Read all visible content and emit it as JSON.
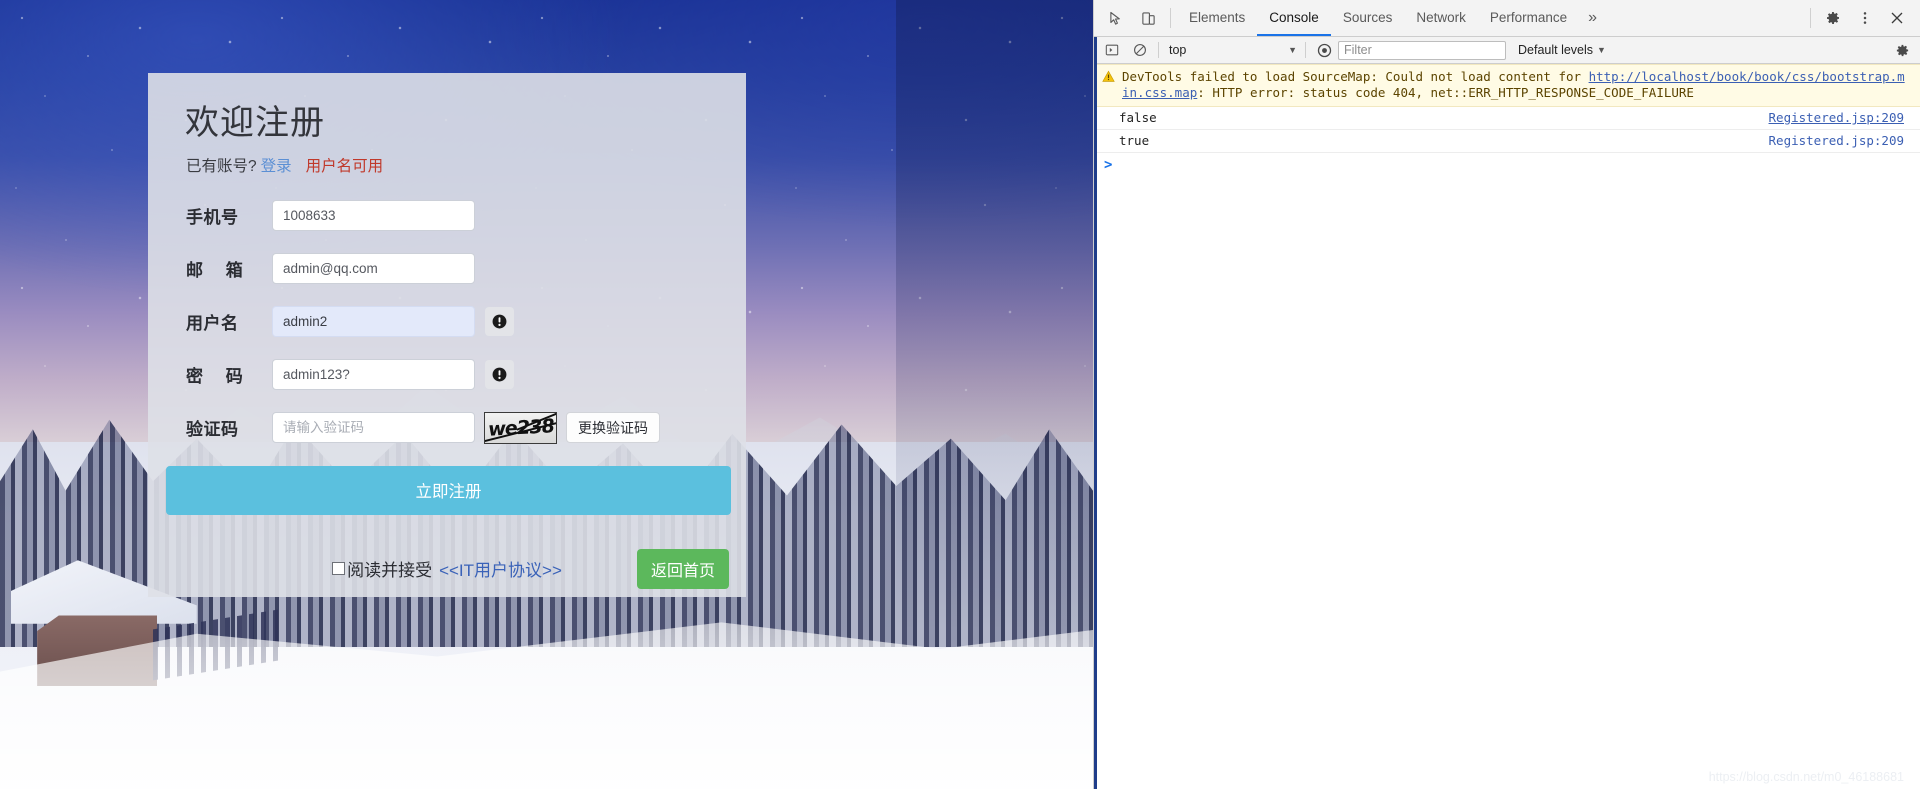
{
  "page": {
    "card": {
      "title": "欢迎注册",
      "have_account_text": "已有账号?",
      "login_link": "登录",
      "username_status": "用户名可用",
      "fields": [
        {
          "label": "手机号",
          "value": "1008633",
          "placeholder": "",
          "has_info": false,
          "autofill": false
        },
        {
          "label": "邮 箱",
          "value": "admin@qq.com",
          "placeholder": "",
          "has_info": false,
          "autofill": false
        },
        {
          "label": "用户名",
          "value": "admin2",
          "placeholder": "",
          "has_info": true,
          "autofill": true
        },
        {
          "label": "密 码",
          "value": "admin123?",
          "placeholder": "",
          "has_info": true,
          "autofill": false
        }
      ],
      "captcha": {
        "label": "验证码",
        "placeholder": "请输入验证码",
        "value": "",
        "image_text": "we238",
        "refresh_label": "更换验证码"
      },
      "submit_label": "立即注册",
      "agree_text": "阅读并接受",
      "agree_link": "<<IT用户协议>>",
      "agree_checked": false,
      "home_label": "返回首页"
    },
    "colors": {
      "submit_bg": "#5bc0de",
      "home_bg": "#5cb85c",
      "login_link": "#5b8fd4",
      "status_red": "#c0392b",
      "agree_link": "#3a62b8",
      "card_bg": "#dee0e7"
    }
  },
  "devtools": {
    "tabs": [
      {
        "label": "Elements",
        "active": false
      },
      {
        "label": "Console",
        "active": true
      },
      {
        "label": "Sources",
        "active": false
      },
      {
        "label": "Network",
        "active": false
      },
      {
        "label": "Performance",
        "active": false
      }
    ],
    "more_tabs_glyph": "»",
    "toolbar": {
      "context": "top",
      "context_caret": "▼",
      "filter_placeholder": "Filter",
      "filter_value": "",
      "levels_label": "Default levels",
      "levels_caret": "▼"
    },
    "console": {
      "warning": {
        "prefix": "DevTools failed to load SourceMap: Could not load content for ",
        "url": "http://localhost/book/book/css/bootstrap.min.css.map",
        "suffix": ": HTTP error: status code 404, net::ERR_HTTP_RESPONSE_CODE_FAILURE"
      },
      "messages": [
        {
          "text": "false",
          "source": "Registered.jsp:209"
        },
        {
          "text": "true",
          "source": "Registered.jsp:209"
        }
      ],
      "prompt_caret": ">",
      "prompt_value": ""
    },
    "accent_blue": "#1a73e8"
  },
  "watermark": "https://blog.csdn.net/m0_46188681"
}
